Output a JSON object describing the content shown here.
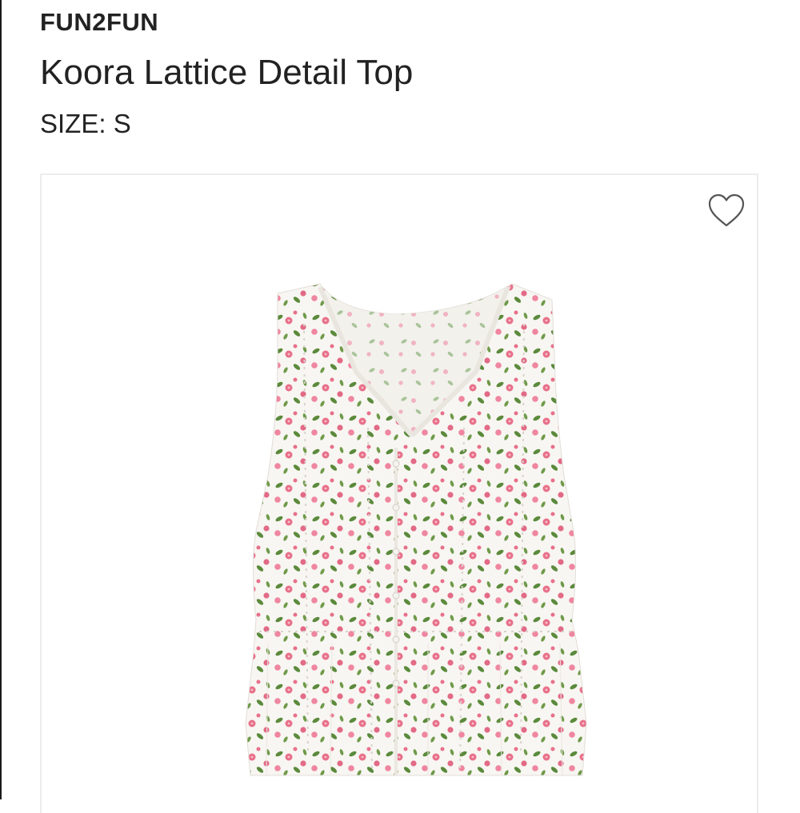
{
  "product": {
    "brand": "FUN2FUN",
    "name": "Koora Lattice Detail Top",
    "size_label": "SIZE:",
    "size_value": "S"
  },
  "actions": {
    "favorite_icon": "heart-outline-icon"
  },
  "colors": {
    "text": "#222222",
    "card_border": "#ececec",
    "fabric": "#f8f6f2",
    "flower_pink": "#e8708a",
    "leaf_green": "#5b8a3c"
  }
}
